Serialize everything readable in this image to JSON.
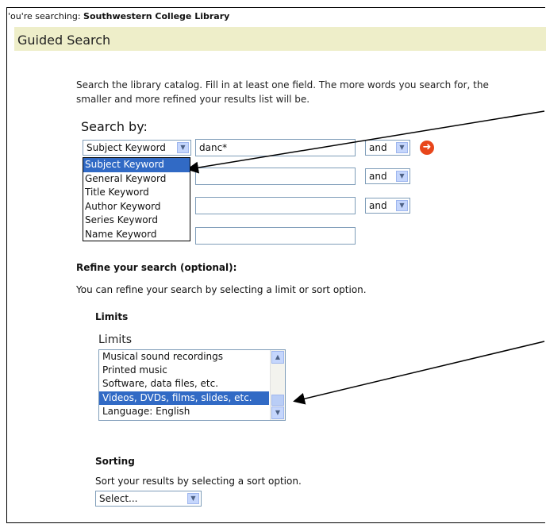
{
  "header": {
    "searching_prefix": "'ou're searching: ",
    "library_name": "Southwestern College Library"
  },
  "page_title": "Guided Search",
  "intro_text": "Search the library catalog. Fill in at least one field. The more words you search for, the smaller and more refined your results list will be.",
  "search_by_label": "Search by:",
  "search_rows": [
    {
      "field_type": "Subject Keyword",
      "value": "danc*",
      "operator": "and"
    },
    {
      "field_type": "",
      "value": "",
      "operator": "and"
    },
    {
      "field_type": "",
      "value": "",
      "operator": "and"
    },
    {
      "field_type": "",
      "value": "",
      "operator": ""
    }
  ],
  "field_type_options": [
    "Subject Keyword",
    "General Keyword",
    "Title Keyword",
    "Author Keyword",
    "Series Keyword",
    "Name Keyword"
  ],
  "selected_field_option": "Subject Keyword",
  "refine": {
    "heading": "Refine your search (optional):",
    "description": "You can refine your search by selecting a limit or sort option."
  },
  "limits": {
    "heading": "Limits",
    "caption": "Limits",
    "items": [
      "Musical sound recordings",
      "Printed music",
      "Software, data files, etc.",
      "Videos, DVDs, films, slides, etc.",
      "Language: English"
    ],
    "selected": "Videos, DVDs, films, slides, etc."
  },
  "sorting": {
    "heading": "Sorting",
    "description": "Sort your results by selecting a sort option.",
    "select_value": "Select..."
  },
  "icons": {
    "go_button": "arrow-right-icon",
    "dropdown_arrow": "chevron-down-icon"
  },
  "colors": {
    "title_bar_bg": "#eeeec9",
    "highlight": "#316ac5",
    "go_button": "#e8461b"
  }
}
